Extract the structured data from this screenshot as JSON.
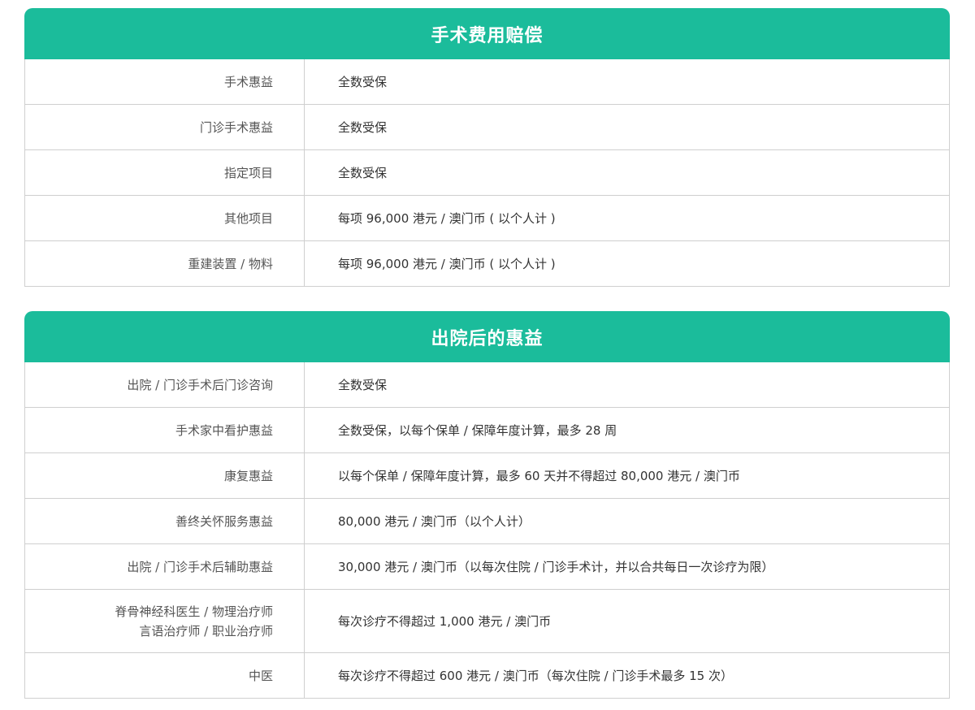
{
  "sections": [
    {
      "title": "手术费用赔偿",
      "rows": [
        {
          "label": "手术惠益",
          "value": "全数受保"
        },
        {
          "label": "门诊手术惠益",
          "value": "全数受保"
        },
        {
          "label": "指定项目",
          "value": "全数受保"
        },
        {
          "label": "其他项目",
          "value": "每项 96,000 港元 / 澳门币 ( 以个人计 )"
        },
        {
          "label": "重建装置 / 物料",
          "value": "每项 96,000 港元 / 澳门币 ( 以个人计 )"
        }
      ]
    },
    {
      "title": "出院后的惠益",
      "rows": [
        {
          "label": "出院 / 门诊手术后门诊咨询",
          "value": "全数受保"
        },
        {
          "label": "手术家中看护惠益",
          "value": "全数受保，以每个保单 / 保障年度计算，最多 28 周"
        },
        {
          "label": "康复惠益",
          "value": "以每个保单 / 保障年度计算，最多 60 天并不得超过 80,000 港元 / 澳门币"
        },
        {
          "label": "善终关怀服务惠益",
          "value": "80,000 港元 / 澳门币（以个人计）"
        },
        {
          "label": "出院 / 门诊手术后辅助惠益",
          "value": "30,000 港元 / 澳门币（以每次住院 / 门诊手术计，并以合共每日一次诊疗为限）"
        },
        {
          "label_line1": "脊骨神经科医生 / 物理治疗师",
          "label_line2": "言语治疗师 / 职业治疗师",
          "value": "每次诊疗不得超过 1,000 港元 / 澳门币"
        },
        {
          "label": "中医",
          "value": "每次诊疗不得超过 600 港元 / 澳门币（每次住院 / 门诊手术最多 15 次）"
        }
      ]
    }
  ]
}
